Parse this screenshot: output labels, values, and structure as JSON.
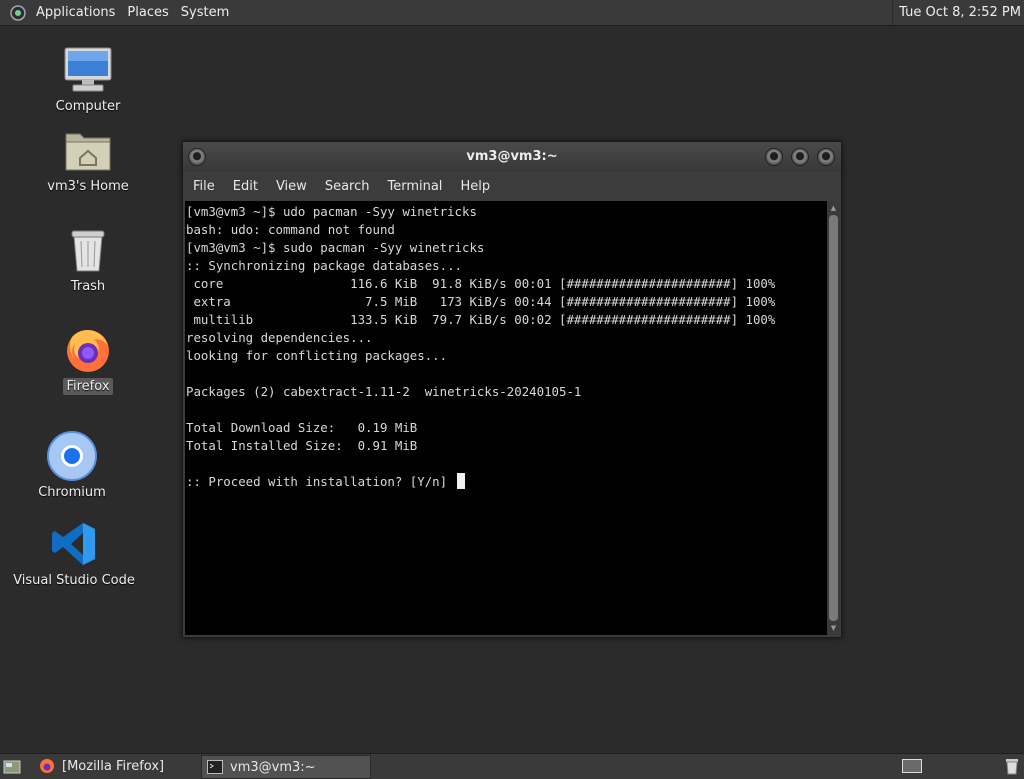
{
  "top_panel": {
    "menus": [
      "Applications",
      "Places",
      "System"
    ],
    "clock": "Tue Oct  8,  2:52 PM"
  },
  "desktop": {
    "icons": [
      {
        "label": "Computer",
        "icon": "computer-icon"
      },
      {
        "label": "vm3's Home",
        "icon": "home-folder-icon"
      },
      {
        "label": "Trash",
        "icon": "trash-icon"
      },
      {
        "label": "Firefox",
        "icon": "firefox-icon"
      },
      {
        "label": "Chromium",
        "icon": "chromium-icon"
      },
      {
        "label": "Visual Studio Code",
        "icon": "vscode-icon"
      }
    ]
  },
  "terminal_window": {
    "title": "vm3@vm3:~",
    "menu": [
      "File",
      "Edit",
      "View",
      "Search",
      "Terminal",
      "Help"
    ],
    "lines": [
      "[vm3@vm3 ~]$ udo pacman -Syy winetricks",
      "bash: udo: command not found",
      "[vm3@vm3 ~]$ sudo pacman -Syy winetricks",
      ":: Synchronizing package databases...",
      " core                 116.6 KiB  91.8 KiB/s 00:01 [######################] 100%",
      " extra                  7.5 MiB   173 KiB/s 00:44 [######################] 100%",
      " multilib             133.5 KiB  79.7 KiB/s 00:02 [######################] 100%",
      "resolving dependencies...",
      "looking for conflicting packages...",
      "",
      "Packages (2) cabextract-1.11-2  winetricks-20240105-1",
      "",
      "Total Download Size:   0.19 MiB",
      "Total Installed Size:  0.91 MiB",
      "",
      ":: Proceed with installation? [Y/n] "
    ]
  },
  "taskbar": {
    "tasks": [
      {
        "label": "[Mozilla Firefox]",
        "icon": "firefox-icon"
      },
      {
        "label": "vm3@vm3:~",
        "icon": "terminal-icon"
      }
    ]
  }
}
